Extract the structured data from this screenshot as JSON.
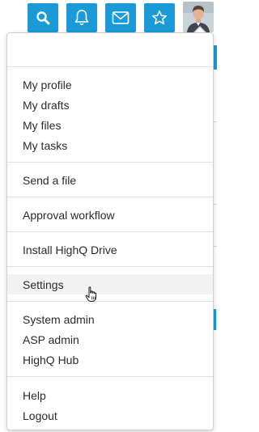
{
  "toolbar": {
    "buttons": [
      {
        "name": "search-button",
        "icon": "search-icon"
      },
      {
        "name": "notifications-button",
        "icon": "bell-icon"
      },
      {
        "name": "messages-button",
        "icon": "envelope-icon"
      },
      {
        "name": "favorites-button",
        "icon": "star-icon"
      }
    ],
    "accent": "#1a9ad6"
  },
  "menu": {
    "groups": [
      {
        "items": [
          "My profile",
          "My drafts",
          "My files",
          "My tasks"
        ]
      },
      {
        "items": [
          "Send a file"
        ]
      },
      {
        "items": [
          "Approval workflow"
        ]
      },
      {
        "items": [
          "Install HighQ Drive"
        ]
      },
      {
        "items": [
          "Settings"
        ]
      },
      {
        "items": [
          "System admin",
          "ASP admin",
          "HighQ Hub"
        ]
      },
      {
        "items": [
          "Help",
          "Logout"
        ]
      }
    ],
    "hovered_item": "Settings",
    "text_color": "#2b2b2b",
    "hover_background": "#f2f2f2"
  }
}
